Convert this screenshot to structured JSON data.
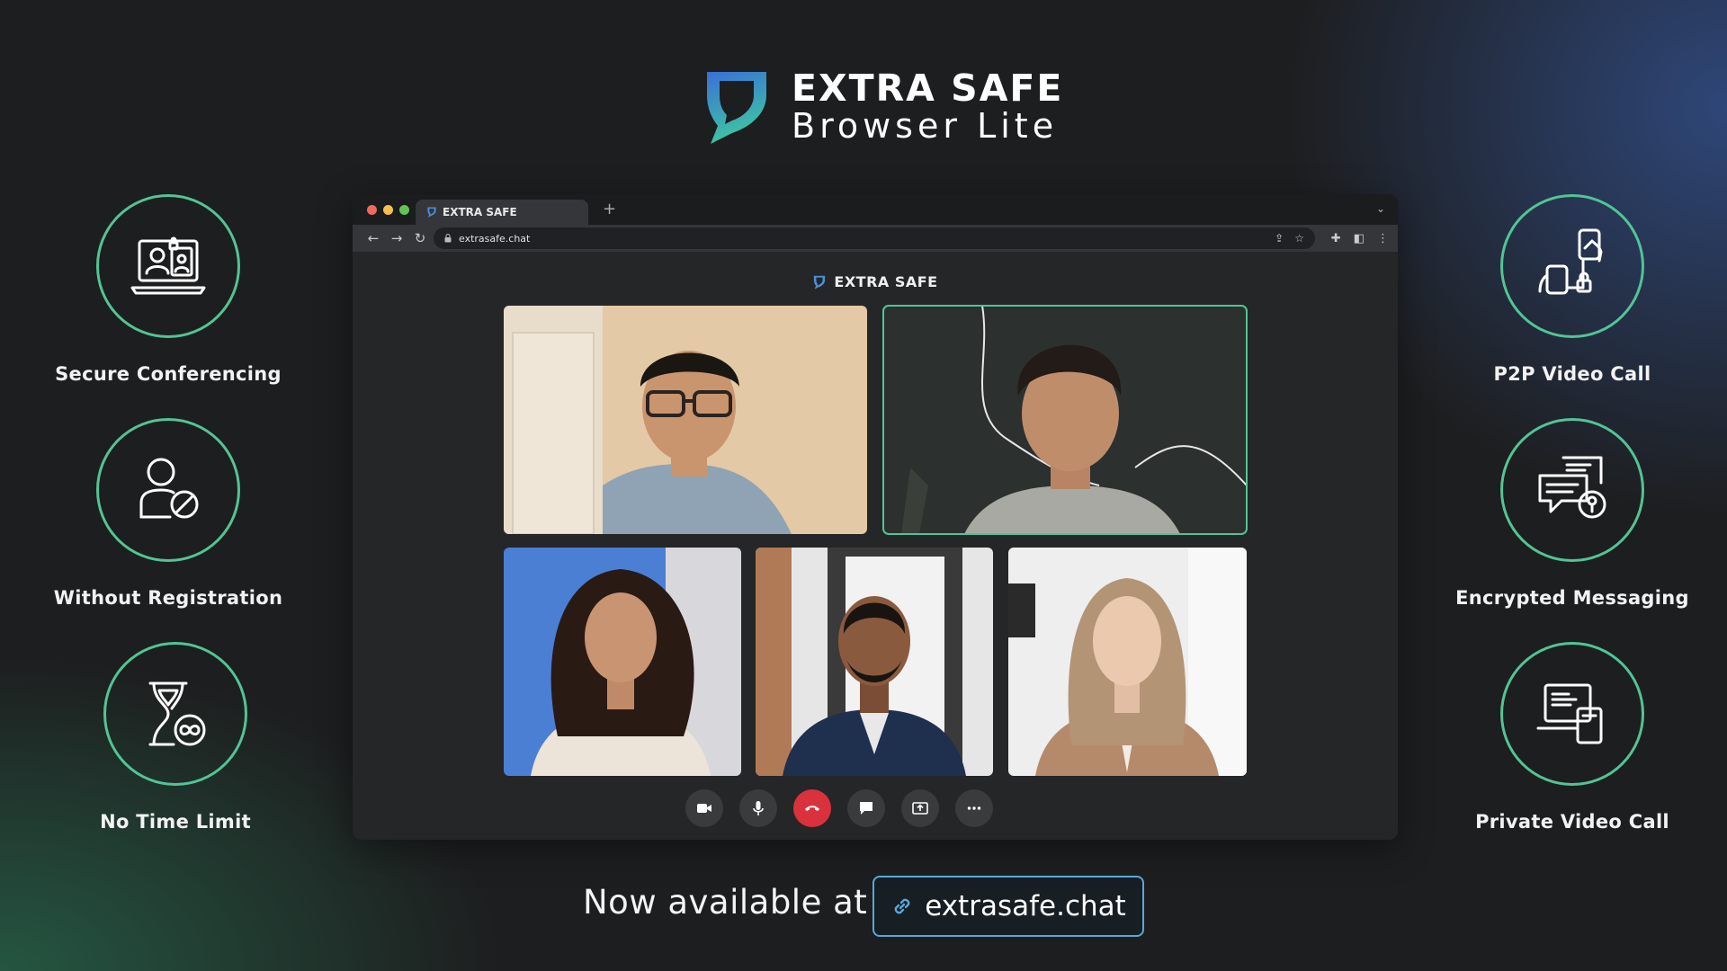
{
  "brand": {
    "title": "EXTRA SAFE",
    "subtitle": "Browser Lite"
  },
  "features_left": [
    {
      "label": "Secure Conferencing",
      "icon": "laptop-users-icon"
    },
    {
      "label": "Without Registration",
      "icon": "user-blocked-icon"
    },
    {
      "label": "No Time Limit",
      "icon": "hourglass-infinity-icon"
    }
  ],
  "features_right": [
    {
      "label": "P2P Video Call",
      "icon": "phones-lock-icon"
    },
    {
      "label": "Encrypted Messaging",
      "icon": "chat-lock-icon"
    },
    {
      "label": "Private Video Call",
      "icon": "devices-icon"
    }
  ],
  "browser": {
    "tab_title": "EXTRA SAFE",
    "new_tab_symbol": "+",
    "url": "extrasafe.chat"
  },
  "app": {
    "header_brand": "EXTRA SAFE"
  },
  "participants": [
    {
      "name": "participant-1",
      "speaking": false
    },
    {
      "name": "participant-2",
      "speaking": true
    },
    {
      "name": "participant-3",
      "speaking": false
    },
    {
      "name": "participant-4",
      "speaking": false
    },
    {
      "name": "participant-5",
      "speaking": false
    }
  ],
  "controls": [
    {
      "icon": "camera-icon"
    },
    {
      "icon": "microphone-icon"
    },
    {
      "icon": "hang-up-icon"
    },
    {
      "icon": "chat-icon"
    },
    {
      "icon": "screen-share-icon"
    },
    {
      "icon": "more-icon"
    }
  ],
  "cta": {
    "text": "Now available at",
    "link": "extrasafe.chat"
  },
  "colors": {
    "accent_green": "#52c495",
    "link_border": "#5aa8d8",
    "hangup_red": "#d9323d"
  }
}
